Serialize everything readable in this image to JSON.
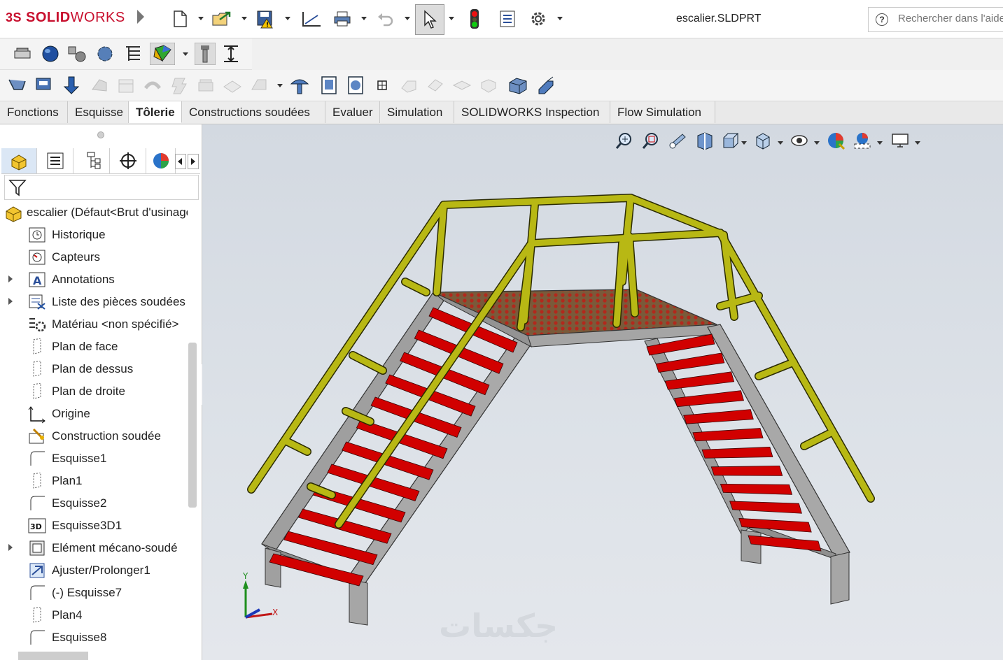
{
  "app": {
    "brand_prefix": "3S",
    "brand_name": "SOLID",
    "brand_name2": "WORKS",
    "document_title": "escalier.SLDPRT",
    "search_placeholder": "Rechercher dans l'aide"
  },
  "tabs": [
    {
      "label": "Fonctions",
      "active": false
    },
    {
      "label": "Esquisse",
      "active": false
    },
    {
      "label": "Tôlerie",
      "active": true
    },
    {
      "label": "Constructions soudées",
      "active": false
    },
    {
      "label": "Evaluer",
      "active": false
    },
    {
      "label": "Simulation",
      "active": false
    },
    {
      "label": "SOLIDWORKS Inspection",
      "active": false
    },
    {
      "label": "Flow Simulation",
      "active": false
    }
  ],
  "tree": {
    "root": "escalier  (Défaut<Brut d'usinage>",
    "items": [
      {
        "label": "Historique",
        "icon": "history-icon",
        "expandable": false
      },
      {
        "label": "Capteurs",
        "icon": "sensor-icon",
        "expandable": false
      },
      {
        "label": "Annotations",
        "icon": "annotation-icon",
        "expandable": true
      },
      {
        "label": "Liste des pièces soudées",
        "icon": "cutlist-icon",
        "expandable": true
      },
      {
        "label": "Matériau <non spécifié>",
        "icon": "material-icon",
        "expandable": false
      },
      {
        "label": "Plan de face",
        "icon": "plane-icon",
        "expandable": false
      },
      {
        "label": "Plan de dessus",
        "icon": "plane-icon",
        "expandable": false
      },
      {
        "label": "Plan de droite",
        "icon": "plane-icon",
        "expandable": false
      },
      {
        "label": "Origine",
        "icon": "origin-icon",
        "expandable": false
      },
      {
        "label": "Construction soudée",
        "icon": "weldment-icon",
        "expandable": false
      },
      {
        "label": "Esquisse1",
        "icon": "sketch-icon",
        "expandable": false
      },
      {
        "label": "Plan1",
        "icon": "plane-icon",
        "expandable": false
      },
      {
        "label": "Esquisse2",
        "icon": "sketch-icon",
        "expandable": false
      },
      {
        "label": "Esquisse3D1",
        "icon": "sketch3d-icon",
        "expandable": false
      },
      {
        "label": "Elément mécano-soudé",
        "icon": "structural-member-icon",
        "expandable": true
      },
      {
        "label": "Ajuster/Prolonger1",
        "icon": "trim-extend-icon",
        "expandable": false
      },
      {
        "label": "(-) Esquisse7",
        "icon": "sketch-icon",
        "expandable": false
      },
      {
        "label": "Plan4",
        "icon": "plane-icon",
        "expandable": false
      },
      {
        "label": "Esquisse8",
        "icon": "sketch-icon",
        "expandable": false
      }
    ]
  },
  "triad": {
    "x": "X",
    "y": "Y"
  },
  "watermark": "جكسات",
  "colors": {
    "railing": "#b8b814",
    "steps": "#d10000",
    "frame": "#a8a8a8",
    "grating": "#8a4a32",
    "brand": "#c8102e"
  }
}
